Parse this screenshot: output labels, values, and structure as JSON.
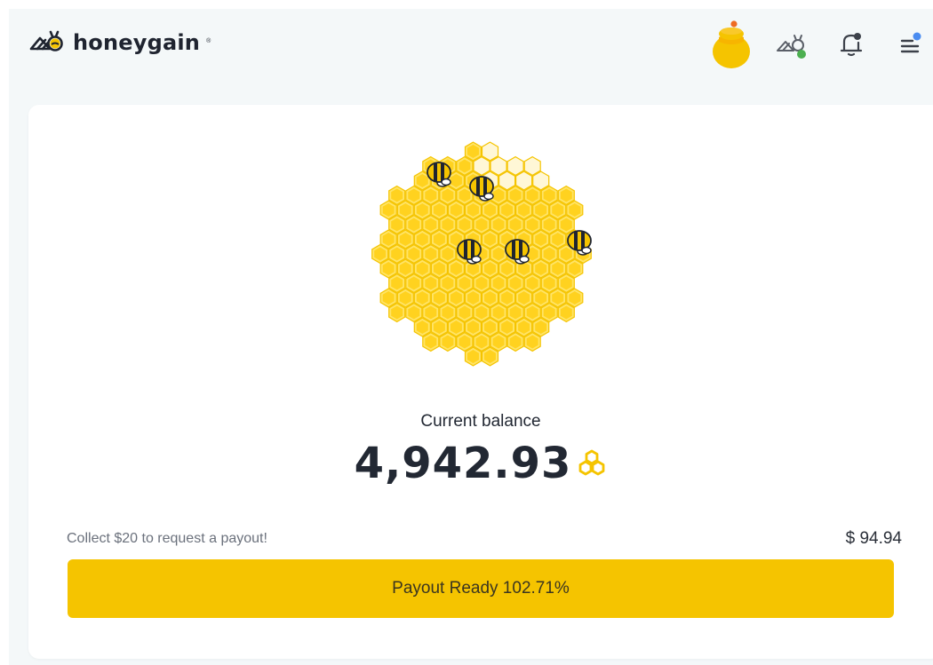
{
  "app": {
    "logo_text": "honeygain",
    "logo_mark": "®"
  },
  "header": {
    "icons": [
      "honey-jar-icon",
      "bee-status-icon",
      "bell-icon",
      "menu-icon"
    ],
    "status_color": "#4caf50",
    "notification_dot_color": "#4a8cf0"
  },
  "balance": {
    "label": "Current balance",
    "value": "4,942.93",
    "unit_icon": "honeycomb-icon"
  },
  "payout": {
    "message": "Collect $20 to request a payout!",
    "amount": "$ 94.94",
    "button_label": "Payout Ready 102.71%",
    "progress_percent": 102.71
  },
  "colors": {
    "accent": "#f5c400",
    "honey": "#ffd21f",
    "text": "#222833"
  }
}
